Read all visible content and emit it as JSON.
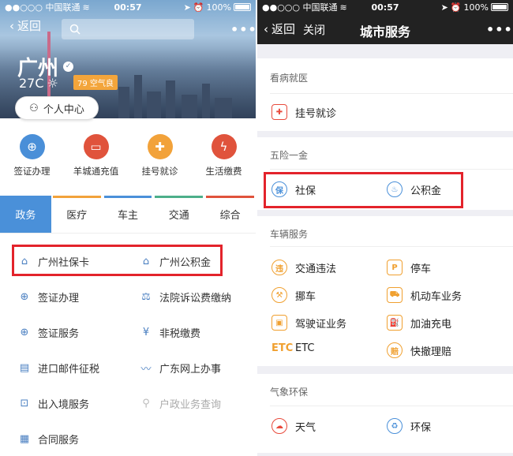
{
  "left": {
    "status": {
      "carrier": "●●○○○ 中国联通",
      "time": "00:57",
      "battery": "100%"
    },
    "back_label": "返回",
    "more_label": "•••",
    "city": "广州",
    "temperature": "27C",
    "aqi": "79 空气良",
    "personal_center": "个人中心",
    "quick_actions": [
      {
        "label": "签证办理",
        "color": "#4a8fd8",
        "icon": "globe-icon"
      },
      {
        "label": "羊城通充值",
        "color": "#e0533c",
        "icon": "card-icon"
      },
      {
        "label": "挂号就诊",
        "color": "#f2a23a",
        "icon": "hospital-icon"
      },
      {
        "label": "生活缴费",
        "color": "#e0533c",
        "icon": "bolt-icon"
      }
    ],
    "tabs": [
      {
        "label": "政务",
        "color": "#4a90d9"
      },
      {
        "label": "医疗",
        "color": "#f2a23a"
      },
      {
        "label": "车主",
        "color": "#4a90d9"
      },
      {
        "label": "交通",
        "color": "#4caf8a"
      },
      {
        "label": "综合",
        "color": "#e0533c"
      }
    ],
    "services": [
      {
        "label": "广州社保卡",
        "icon": "social-security-icon"
      },
      {
        "label": "广州公积金",
        "icon": "fund-icon"
      },
      {
        "label": "签证办理",
        "icon": "globe-icon"
      },
      {
        "label": "法院诉讼费缴纳",
        "icon": "scales-icon"
      },
      {
        "label": "签证服务",
        "icon": "globe-icon"
      },
      {
        "label": "非税缴费",
        "icon": "yen-icon"
      },
      {
        "label": "进口邮件征税",
        "icon": "mail-icon"
      },
      {
        "label": "广东网上办事",
        "icon": "swoosh-icon"
      },
      {
        "label": "出入境服务",
        "icon": "passport-icon"
      },
      {
        "label": "户政业务查询",
        "icon": "search-person-icon"
      },
      {
        "label": "合同服务",
        "icon": "contract-icon"
      }
    ]
  },
  "right": {
    "status": {
      "carrier": "●●○○○ 中国联通",
      "time": "00:57",
      "battery": "100%"
    },
    "back_label": "返回",
    "close_label": "关闭",
    "title": "城市服务",
    "more_label": "•••",
    "sections": [
      {
        "header": "看病就医",
        "items": [
          {
            "label": "挂号就诊",
            "icon": "hospital-icon"
          }
        ]
      },
      {
        "header": "五险一金",
        "items": [
          {
            "label": "社保",
            "icon": "social-security-icon",
            "glyph": "保"
          },
          {
            "label": "公积金",
            "icon": "piggy-bank-icon"
          }
        ]
      },
      {
        "header": "车辆服务",
        "items": [
          {
            "label": "交通违法",
            "icon": "violation-icon",
            "glyph": "违"
          },
          {
            "label": "停车",
            "icon": "parking-icon",
            "glyph": "P"
          },
          {
            "label": "挪车",
            "icon": "move-car-icon"
          },
          {
            "label": "机动车业务",
            "icon": "vehicle-icon"
          },
          {
            "label": "驾驶证业务",
            "icon": "license-icon"
          },
          {
            "label": "加油充电",
            "icon": "fuel-icon"
          },
          {
            "label": "ETC",
            "icon": "etc-icon",
            "glyph": "ETC"
          },
          {
            "label": "快撤理赔",
            "icon": "claim-icon",
            "glyph": "赔"
          }
        ]
      },
      {
        "header": "气象环保",
        "items": [
          {
            "label": "天气",
            "icon": "weather-icon"
          },
          {
            "label": "环保",
            "icon": "recycle-icon"
          }
        ]
      }
    ]
  }
}
